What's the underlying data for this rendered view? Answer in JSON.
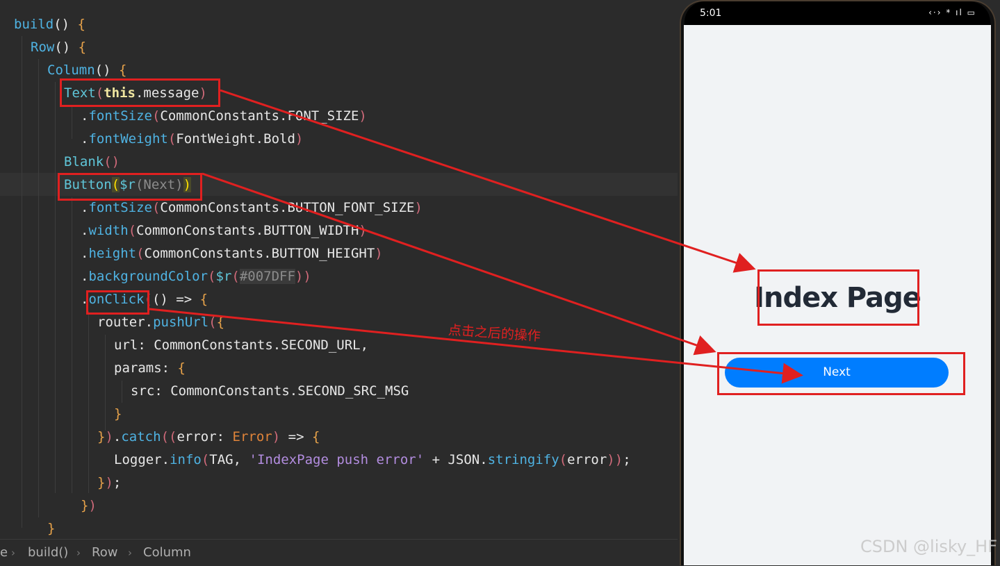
{
  "editor": {
    "lines": [
      {
        "tokens": [
          [
            "fn",
            "build"
          ],
          [
            "tx",
            "() "
          ],
          [
            "br",
            "{"
          ]
        ]
      },
      {
        "tokens": [
          [
            "fn",
            "Row"
          ],
          [
            "tx",
            "() "
          ],
          [
            "br",
            "{"
          ]
        ]
      },
      {
        "tokens": [
          [
            "fn",
            "Column"
          ],
          [
            "tx",
            "() "
          ],
          [
            "br",
            "{"
          ]
        ]
      },
      {
        "tokens": [
          [
            "kw",
            "Text"
          ],
          [
            "rp",
            "("
          ],
          [
            "bd",
            "this"
          ],
          [
            "tx",
            ".message"
          ],
          [
            "rp",
            ")"
          ]
        ]
      },
      {
        "tokens": [
          [
            "tx",
            "."
          ],
          [
            "fn",
            "fontSize"
          ],
          [
            "rp",
            "("
          ],
          [
            "tx",
            "CommonConstants.FONT_SIZE"
          ],
          [
            "rp",
            ")"
          ]
        ]
      },
      {
        "tokens": [
          [
            "tx",
            "."
          ],
          [
            "fn",
            "fontWeight"
          ],
          [
            "rp",
            "("
          ],
          [
            "tx",
            "FontWeight.Bold"
          ],
          [
            "rp",
            ")"
          ]
        ]
      },
      {
        "tokens": [
          [
            "kw",
            "Blank"
          ],
          [
            "rp",
            "()"
          ]
        ]
      },
      {
        "tokens": [
          [
            "kw",
            "Button"
          ],
          [
            "yl",
            "("
          ],
          [
            "kw",
            "$r"
          ],
          [
            "dim",
            "(Next)"
          ],
          [
            "yl",
            ")"
          ]
        ]
      },
      {
        "tokens": [
          [
            "tx",
            "."
          ],
          [
            "fn",
            "fontSize"
          ],
          [
            "rp",
            "("
          ],
          [
            "tx",
            "CommonConstants.BUTTON_FONT_SIZE"
          ],
          [
            "rp",
            ")"
          ]
        ]
      },
      {
        "tokens": [
          [
            "tx",
            "."
          ],
          [
            "fn",
            "width"
          ],
          [
            "rp",
            "("
          ],
          [
            "tx",
            "CommonConstants.BUTTON_WIDTH"
          ],
          [
            "rp",
            ")"
          ]
        ]
      },
      {
        "tokens": [
          [
            "tx",
            "."
          ],
          [
            "fn",
            "height"
          ],
          [
            "rp",
            "("
          ],
          [
            "tx",
            "CommonConstants.BUTTON_HEIGHT"
          ],
          [
            "rp",
            ")"
          ]
        ]
      },
      {
        "tokens": [
          [
            "tx",
            "."
          ],
          [
            "fn",
            "backgroundColor"
          ],
          [
            "rp",
            "("
          ],
          [
            "kw",
            "$r"
          ],
          [
            "rp",
            "("
          ],
          [
            "hex",
            "#007DFF"
          ],
          [
            "rp",
            "))"
          ]
        ]
      },
      {
        "tokens": [
          [
            "tx",
            "."
          ],
          [
            "fn",
            "onClick"
          ],
          [
            "rp",
            "("
          ],
          [
            "tx",
            "() => "
          ],
          [
            "br",
            "{"
          ]
        ]
      },
      {
        "tokens": [
          [
            "tx",
            "router."
          ],
          [
            "fn",
            "pushUrl"
          ],
          [
            "rp",
            "("
          ],
          [
            "br",
            "{"
          ]
        ]
      },
      {
        "tokens": [
          [
            "tx",
            "url: CommonConstants.SECOND_URL,"
          ]
        ]
      },
      {
        "tokens": [
          [
            "tx",
            "params: "
          ],
          [
            "br",
            "{"
          ]
        ]
      },
      {
        "tokens": [
          [
            "tx",
            "src: CommonConstants.SECOND_SRC_MSG"
          ]
        ]
      },
      {
        "tokens": [
          [
            "br",
            "}"
          ]
        ]
      },
      {
        "tokens": [
          [
            "br",
            "}"
          ],
          [
            "rp",
            ")"
          ],
          [
            "tx",
            "."
          ],
          [
            "fn",
            "catch"
          ],
          [
            "rp",
            "(("
          ],
          [
            "tx",
            "error: "
          ],
          [
            "typ",
            "Error"
          ],
          [
            "rp",
            ")"
          ],
          [
            "tx",
            " => "
          ],
          [
            "br",
            "{"
          ]
        ]
      },
      {
        "tokens": [
          [
            "tx",
            "Logger."
          ],
          [
            "fn",
            "info"
          ],
          [
            "rp",
            "("
          ],
          [
            "tx",
            "TAG, "
          ],
          [
            "str",
            "'IndexPage push error'"
          ],
          [
            "tx",
            " + JSON."
          ],
          [
            "fn",
            "stringify"
          ],
          [
            "rp",
            "("
          ],
          [
            "tx",
            "error"
          ],
          [
            "rp",
            "))"
          ],
          [
            "tx",
            ";"
          ]
        ]
      },
      {
        "tokens": [
          [
            "br",
            "}"
          ],
          [
            "rp",
            ")"
          ],
          [
            "tx",
            ";"
          ]
        ]
      },
      {
        "tokens": [
          [
            "br",
            "}"
          ],
          [
            "rp",
            ")"
          ]
        ]
      },
      {
        "tokens": [
          [
            "br",
            "}"
          ]
        ]
      }
    ]
  },
  "breadcrumb": {
    "items": [
      "e",
      "build()",
      "Row",
      "Column"
    ],
    "separator": "›"
  },
  "annotation": {
    "note": "点击之后的操作",
    "color": "#e02020"
  },
  "phone": {
    "status": {
      "time": "5:01",
      "icons": "‹·› * ıl ▭"
    },
    "page_title": "Index Page",
    "button_label": "Next",
    "button_color": "#007DFF"
  },
  "watermark": "CSDN @lisky_HF"
}
